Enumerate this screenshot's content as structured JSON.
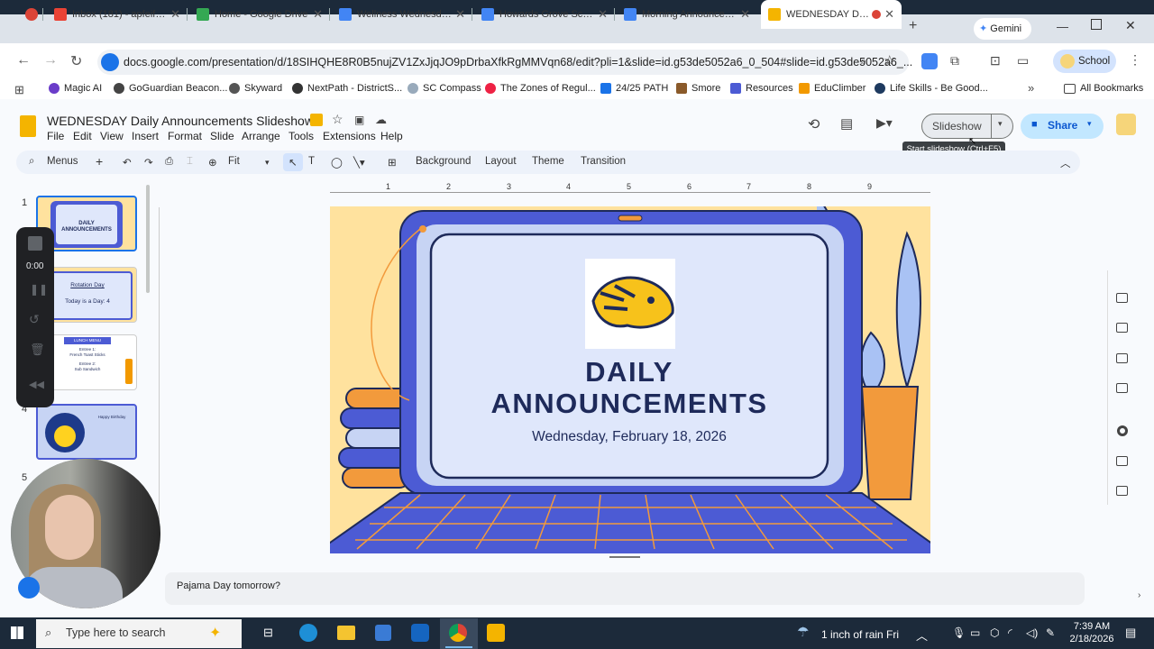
{
  "browser": {
    "tabs": [
      {
        "title": "",
        "color": "#db4437"
      },
      {
        "title": "Inbox (181) - apfeifer@",
        "color": "#ea4335"
      },
      {
        "title": "Home - Google Drive",
        "color": "#34a853"
      },
      {
        "title": "Wellness Wednesday",
        "color": "#4285f4"
      },
      {
        "title": "Howards Grove Schoo",
        "color": "#4285f4"
      },
      {
        "title": "Morning Announceme",
        "color": "#4285f4"
      },
      {
        "title": "WEDNESDAY Daily",
        "color": "#f4b400"
      }
    ],
    "gemini_label": "Gemini",
    "url": "docs.google.com/presentation/d/18SIHQHE8R0B5nujZV1ZxJjqJO9pDrbaXfkRgMMVqn68/edit?pli=1&slide=id.g53de5052a6_0_504#slide=id.g53de5052a6_...",
    "profile_label": "School",
    "bookmarks": [
      {
        "label": "Magic AI",
        "color": "#6a3cc9"
      },
      {
        "label": "GoGuardian Beacon...",
        "color": "#444"
      },
      {
        "label": "Skyward",
        "color": "#555"
      },
      {
        "label": "NextPath - DistrictS...",
        "color": "#333"
      },
      {
        "label": "SC Compass",
        "color": "#9ab"
      },
      {
        "label": "The Zones of Regul...",
        "color": "#e24"
      },
      {
        "label": "24/25 PATH",
        "color": "#1a73e8"
      },
      {
        "label": "Smore",
        "color": "#8a5a2a"
      },
      {
        "label": "Resources",
        "color": "#4c5bd4"
      },
      {
        "label": "EduClimber",
        "color": "#f29900"
      },
      {
        "label": "Life Skills - Be Good...",
        "color": "#1e3a5f"
      }
    ],
    "all_bookmarks_label": "All Bookmarks"
  },
  "slides_app": {
    "doc_title": "WEDNESDAY Daily Announcements Slideshow",
    "menus": [
      "File",
      "Edit",
      "View",
      "Insert",
      "Format",
      "Slide",
      "Arrange",
      "Tools",
      "Extensions",
      "Help"
    ],
    "slideshow_label": "Slideshow",
    "share_label": "Share",
    "tooltip": "Start slideshow (Ctrl+F5)",
    "toolbar": {
      "menus_label": "Menus",
      "zoom_label": "Fit",
      "background": "Background",
      "layout": "Layout",
      "theme": "Theme",
      "transition": "Transition"
    },
    "ruler_ticks": [
      "1",
      "2",
      "3",
      "4",
      "5",
      "6",
      "7",
      "8",
      "9"
    ],
    "filmstrip": [
      {
        "num": "1",
        "lines": [
          "DAILY",
          "ANNOUNCEMENTS"
        ]
      },
      {
        "num": "",
        "lines": [
          "Rotation Day",
          "Today is a Day: 4"
        ]
      },
      {
        "num": "",
        "lines": [
          "LUNCH MENU",
          "Entree 1:",
          "French Toast Sticks",
          "Entree 2:",
          "Sub Sandwich"
        ]
      },
      {
        "num": "4",
        "lines": [
          "Happy Birthday"
        ]
      },
      {
        "num": "5",
        "lines": []
      }
    ],
    "slide": {
      "title_line1": "DAILY",
      "title_line2": "ANNOUNCEMENTS",
      "date": "Wednesday, February 18, 2026"
    },
    "speaker_notes": "Pajama Day tomorrow?"
  },
  "recorder": {
    "time": "0:00"
  },
  "taskbar": {
    "search_placeholder": "Type here to search",
    "weather": "1 inch of rain Fri",
    "time": "7:39 AM",
    "date": "2/18/2026"
  },
  "colors": {
    "accent": "#0b57d0",
    "slide_bg": "#ffe29e",
    "laptop": "#4c5bd4"
  }
}
